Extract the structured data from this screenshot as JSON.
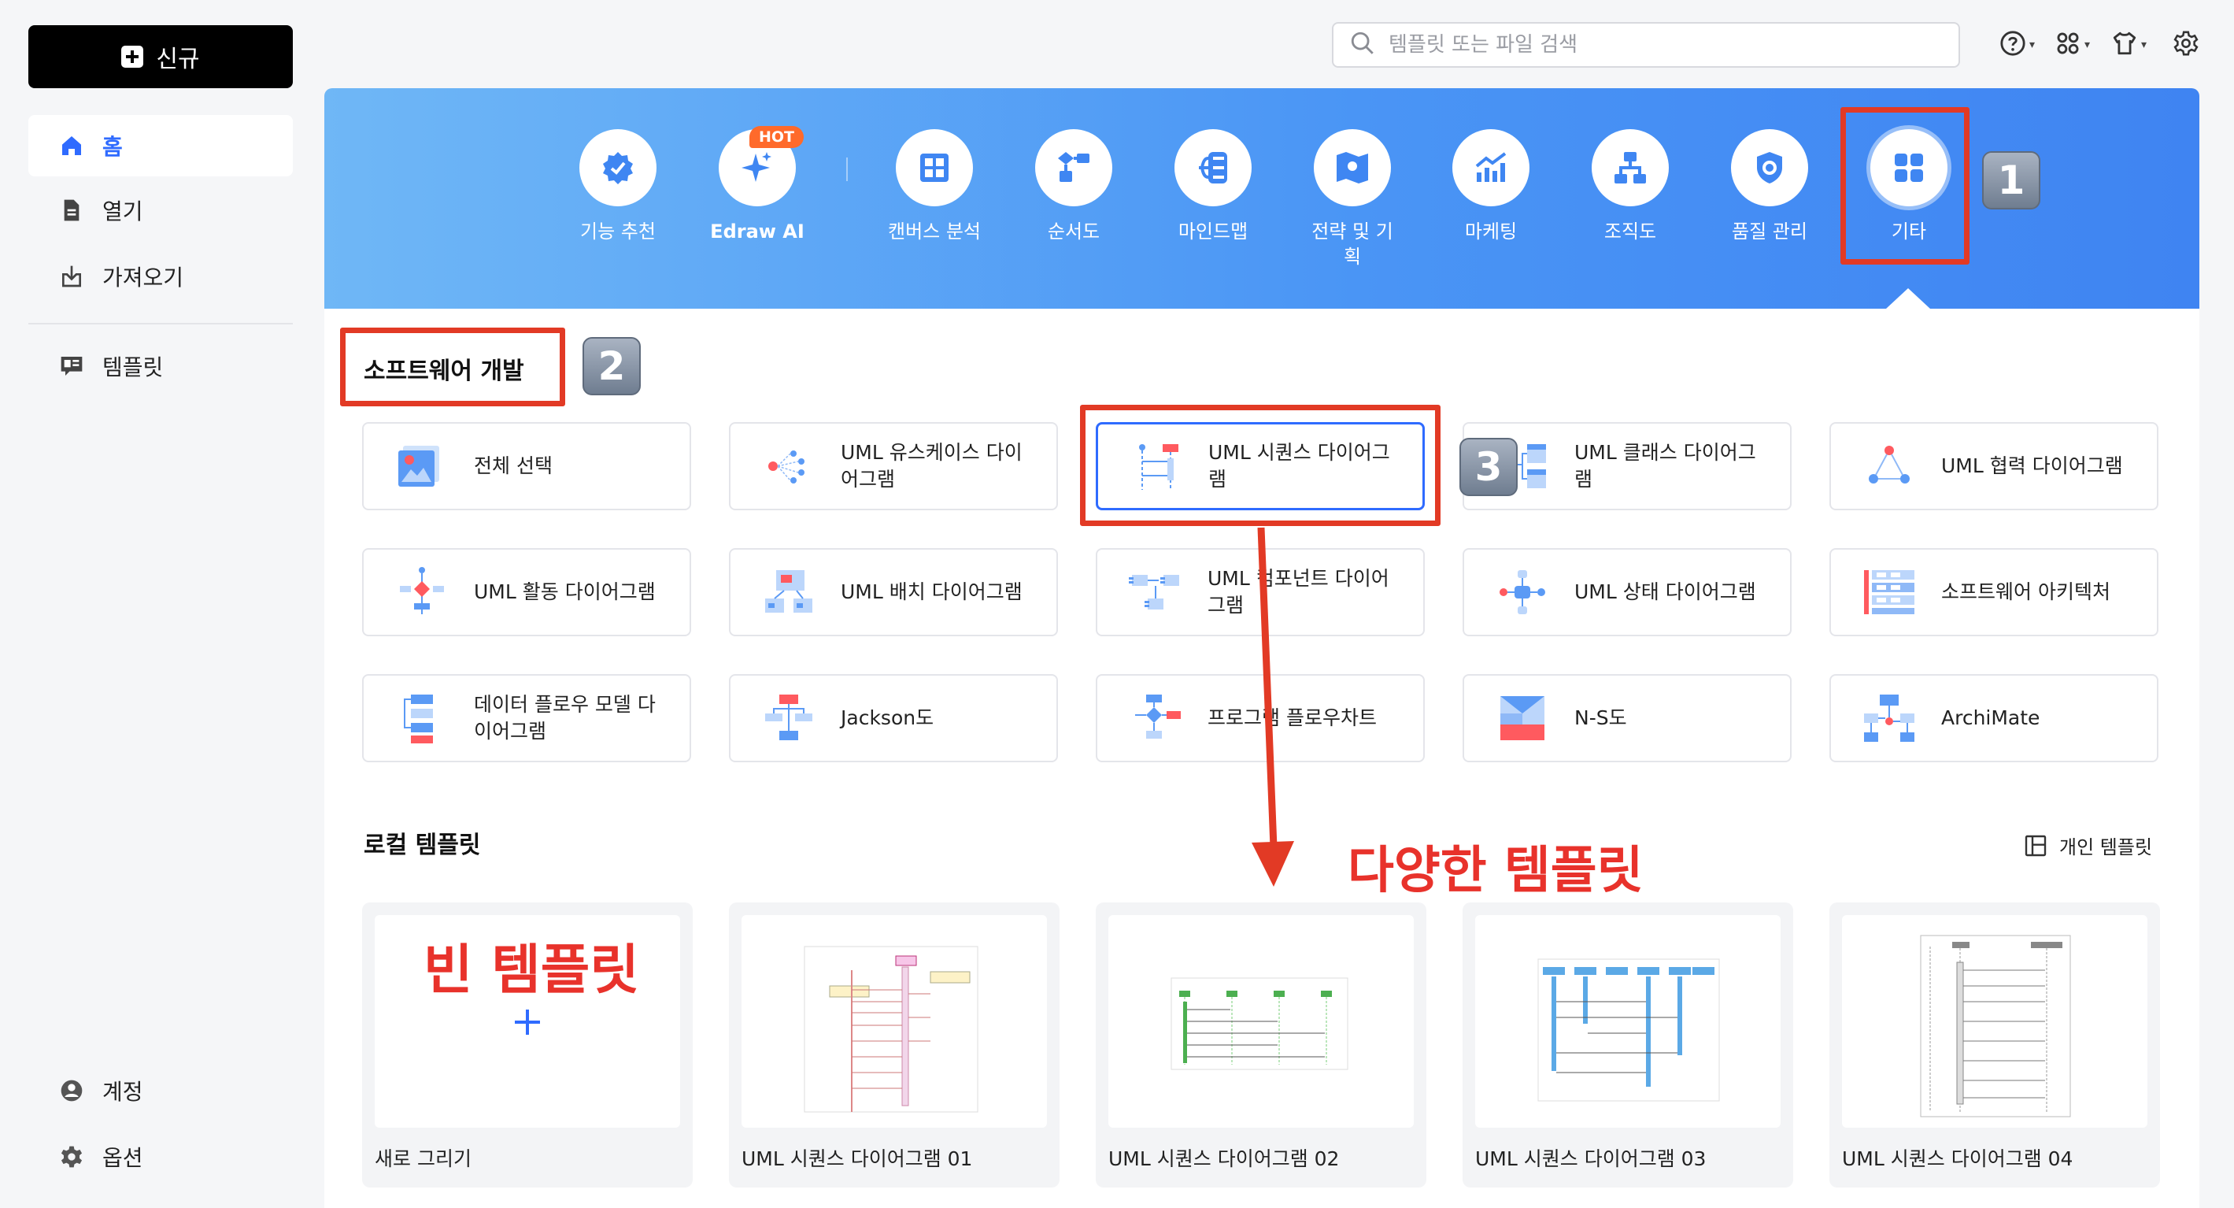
{
  "sidebar": {
    "new_label": "신규",
    "items": [
      {
        "label": "홈"
      },
      {
        "label": "열기"
      },
      {
        "label": "가져오기"
      },
      {
        "label": "템플릿"
      }
    ],
    "bottom": [
      {
        "label": "계정"
      },
      {
        "label": "옵션"
      }
    ]
  },
  "search": {
    "placeholder": "템플릿 또는 파일 검색"
  },
  "categories": [
    {
      "label": "기능 추천"
    },
    {
      "label": "Edraw AI",
      "badge": "HOT"
    },
    {
      "label": "캔버스 분석"
    },
    {
      "label": "순서도"
    },
    {
      "label": "마인드맵"
    },
    {
      "label": "전략 및 기",
      "label2": "획"
    },
    {
      "label": "마케팅"
    },
    {
      "label": "조직도"
    },
    {
      "label": "품질 관리"
    },
    {
      "label": "기타"
    }
  ],
  "software_section": {
    "title": "소프트웨어 개발",
    "templates": [
      {
        "label": "전체 선택"
      },
      {
        "label": "UML 유스케이스 다이어그램"
      },
      {
        "label": "UML 시퀀스 다이어그램"
      },
      {
        "label": "UML 클래스 다이어그램"
      },
      {
        "label": "UML 협력 다이어그램"
      },
      {
        "label": "UML 활동 다이어그램"
      },
      {
        "label": "UML 배치 다이어그램"
      },
      {
        "label": "UML 컴포넌트 다이어그램"
      },
      {
        "label": "UML 상태 다이어그램"
      },
      {
        "label": "소프트웨어 아키텍처"
      },
      {
        "label": "데이터 플로우 모델 다이어그램"
      },
      {
        "label": "Jackson도"
      },
      {
        "label": "프로그램 플로우차트"
      },
      {
        "label": "N-S도"
      },
      {
        "label": "ArchiMate"
      }
    ]
  },
  "local_section": {
    "title": "로컬 템플릿",
    "personal_label": "개인 템플릿",
    "cards": [
      {
        "caption": "새로 그리기"
      },
      {
        "caption": "UML 시퀀스 다이어그램 01"
      },
      {
        "caption": "UML 시퀀스 다이어그램 02"
      },
      {
        "caption": "UML 시퀀스 다이어그램 03"
      },
      {
        "caption": "UML 시퀀스 다이어그램 04"
      }
    ]
  },
  "annotations": {
    "badge1": "1",
    "badge2": "2",
    "badge3": "3",
    "various_templates": "다양한 템플릿",
    "blank_template": "빈 템플릿"
  },
  "colors": {
    "accent": "#2f6bff",
    "annotation_red": "#e23a25",
    "banner_start": "#6fb7f6",
    "banner_end": "#3f84f2"
  }
}
